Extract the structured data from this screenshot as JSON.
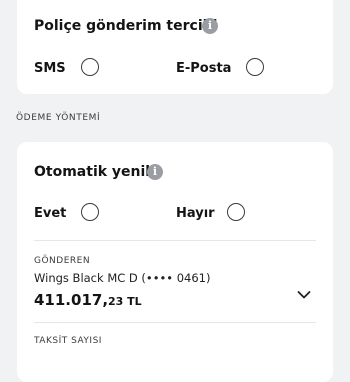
{
  "policy_delivery": {
    "title": "Poliçe gönderim tercihi",
    "info_icon": "i",
    "options": [
      {
        "label": "SMS",
        "selected": false
      },
      {
        "label": "E-Posta",
        "selected": false
      }
    ]
  },
  "payment_section": {
    "label": "ÖDEME YÖNTEMİ"
  },
  "auto_renew": {
    "title": "Otomatik yenile",
    "info_icon": "i",
    "options": [
      {
        "label": "Evet",
        "selected": false
      },
      {
        "label": "Hayır",
        "selected": false
      }
    ]
  },
  "sender": {
    "label": "GÖNDEREN",
    "account": "Wings Black MC D (•••• 0461)",
    "amount_int": "411.017,",
    "amount_dec": "23 TL"
  },
  "installments": {
    "label": "TAKSİT SAYISI"
  },
  "colors": {
    "background": "#f1f2f4",
    "card": "#ffffff",
    "text": "#141414",
    "info_icon": "#9b9da4"
  }
}
